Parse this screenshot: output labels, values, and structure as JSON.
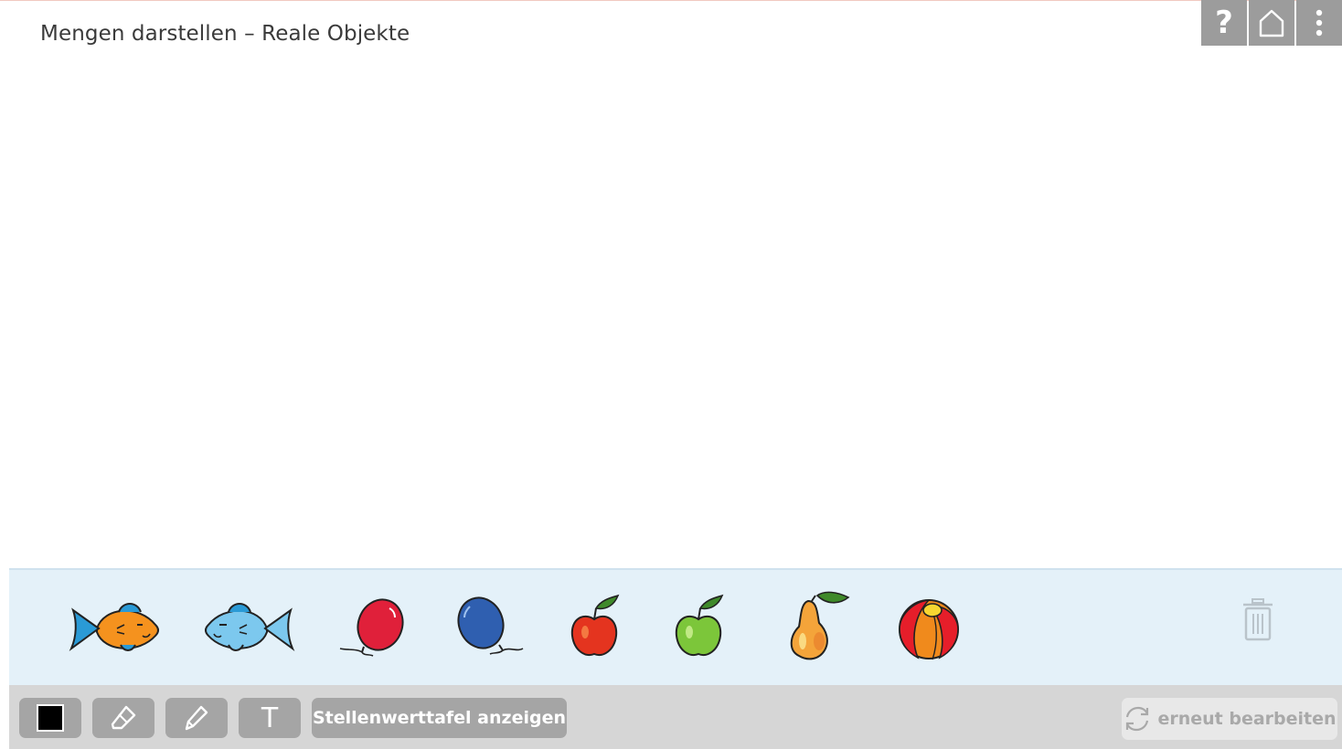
{
  "header": {
    "title": "Mengen darstellen – Reale Objekte"
  },
  "topbar": {
    "buttons": [
      {
        "icon": "help-icon",
        "glyph": "?"
      },
      {
        "icon": "home-icon"
      },
      {
        "icon": "more-vertical-icon"
      }
    ]
  },
  "tray": {
    "items": [
      {
        "name": "fish-orange",
        "color": "#f5921e"
      },
      {
        "name": "fish-blue",
        "color": "#7cc8ee"
      },
      {
        "name": "balloon-red",
        "color": "#e0203a"
      },
      {
        "name": "balloon-blue",
        "color": "#2f5fb0"
      },
      {
        "name": "apple-red",
        "color": "#e4341f"
      },
      {
        "name": "apple-green",
        "color": "#7cc63a"
      },
      {
        "name": "pear",
        "color": "#f4a43a"
      },
      {
        "name": "ball",
        "color": "#f08a1c"
      }
    ],
    "trash_icon": "trash-icon"
  },
  "toolbar": {
    "color_swatch": "#000000",
    "text_tool_label": "T",
    "place_value_button": "Stellenwerttafel anzeigen",
    "retry_button": "erneut bearbeiten"
  },
  "colors": {
    "topbar_bg": "#9c9c9c",
    "tray_bg": "#e4f1f9",
    "toolbar_bg": "#d6d6d6",
    "tool_bg": "#a5a5a5"
  }
}
